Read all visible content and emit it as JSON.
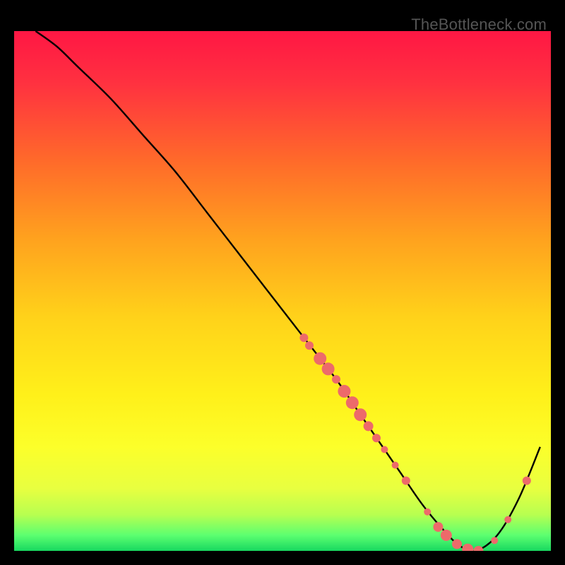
{
  "watermark": "TheBottleneck.com",
  "chart_data": {
    "type": "line",
    "title": "",
    "xlabel": "",
    "ylabel": "",
    "xlim": [
      0,
      100
    ],
    "ylim": [
      0,
      100
    ],
    "grid": false,
    "legend": false,
    "gradient_stops": [
      {
        "offset": 0.0,
        "color": "#ff1744"
      },
      {
        "offset": 0.1,
        "color": "#ff3140"
      },
      {
        "offset": 0.25,
        "color": "#ff6a2a"
      },
      {
        "offset": 0.4,
        "color": "#ffa21e"
      },
      {
        "offset": 0.55,
        "color": "#ffd21a"
      },
      {
        "offset": 0.7,
        "color": "#fff01a"
      },
      {
        "offset": 0.8,
        "color": "#fcff2a"
      },
      {
        "offset": 0.88,
        "color": "#e8ff40"
      },
      {
        "offset": 0.93,
        "color": "#b8ff50"
      },
      {
        "offset": 0.97,
        "color": "#5cff70"
      },
      {
        "offset": 1.0,
        "color": "#18d860"
      }
    ],
    "series": [
      {
        "name": "bottleneck-curve",
        "x": [
          4,
          8,
          12,
          18,
          24,
          30,
          36,
          42,
          48,
          54,
          60,
          64,
          68,
          72,
          76,
          80,
          83,
          86,
          90,
          94,
          98
        ],
        "y": [
          100,
          97,
          93,
          87,
          80,
          73,
          65,
          57,
          49,
          41,
          33,
          27,
          21,
          15,
          9,
          4,
          1,
          0,
          3,
          10,
          20
        ],
        "color": "#000000"
      }
    ],
    "points": [
      {
        "x": 54.0,
        "y": 41.0,
        "r": 6
      },
      {
        "x": 55.0,
        "y": 39.5,
        "r": 6
      },
      {
        "x": 57.0,
        "y": 37.0,
        "r": 9
      },
      {
        "x": 58.5,
        "y": 35.0,
        "r": 9
      },
      {
        "x": 60.0,
        "y": 33.0,
        "r": 6
      },
      {
        "x": 61.5,
        "y": 30.7,
        "r": 9
      },
      {
        "x": 63.0,
        "y": 28.5,
        "r": 9
      },
      {
        "x": 64.5,
        "y": 26.2,
        "r": 9
      },
      {
        "x": 66.0,
        "y": 24.0,
        "r": 7
      },
      {
        "x": 67.5,
        "y": 21.7,
        "r": 6
      },
      {
        "x": 69.0,
        "y": 19.5,
        "r": 5
      },
      {
        "x": 71.0,
        "y": 16.5,
        "r": 5
      },
      {
        "x": 73.0,
        "y": 13.5,
        "r": 6
      },
      {
        "x": 77.0,
        "y": 7.5,
        "r": 5
      },
      {
        "x": 79.0,
        "y": 4.6,
        "r": 7
      },
      {
        "x": 80.5,
        "y": 3.0,
        "r": 8
      },
      {
        "x": 82.5,
        "y": 1.3,
        "r": 7
      },
      {
        "x": 84.5,
        "y": 0.3,
        "r": 8
      },
      {
        "x": 86.5,
        "y": 0.0,
        "r": 7
      },
      {
        "x": 89.5,
        "y": 2.0,
        "r": 5
      },
      {
        "x": 92.0,
        "y": 6.0,
        "r": 5
      },
      {
        "x": 95.5,
        "y": 13.5,
        "r": 6
      }
    ],
    "point_color": "#ed6a6a"
  }
}
